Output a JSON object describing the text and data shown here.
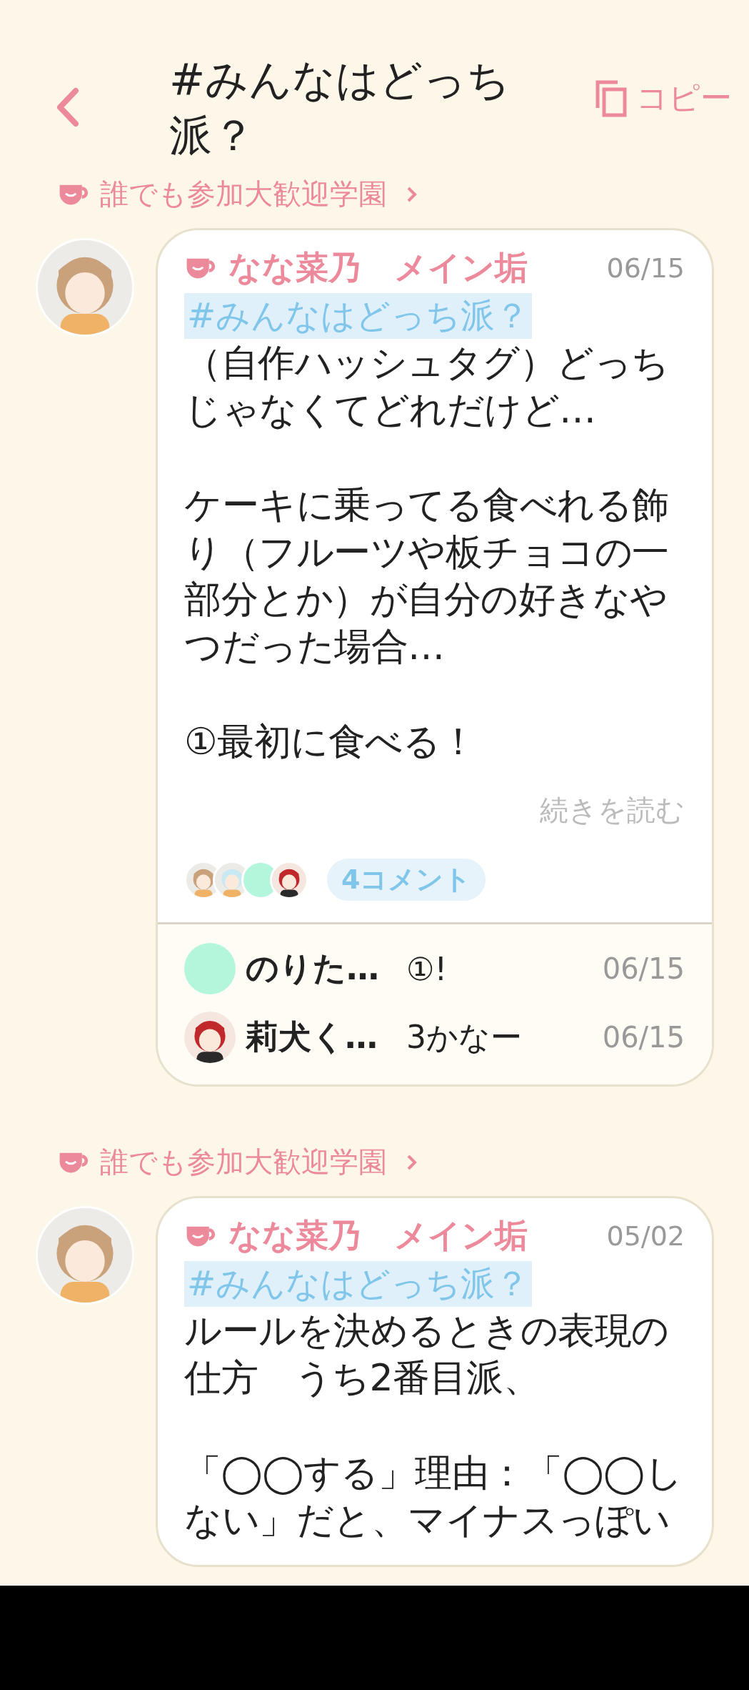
{
  "header": {
    "title": "#みんなはどっち派？",
    "copy_label": "コピー"
  },
  "posts": [
    {
      "community": "誰でも参加大歓迎学園",
      "author": "なな菜乃　メイン垢",
      "date": "06/15",
      "hashtag": "#みんなはどっち派？",
      "paragraphs": [
        "（自作ハッシュタグ）どっちじゃなくてどれだけど…",
        "ケーキに乗ってる食べれる飾り（フルーツや板チョコの一部分とか）が自分の好きなやつだった場合…",
        "①最初に食べる！"
      ],
      "read_more": "続きを読む",
      "commenters": [
        {
          "kind": "picture"
        },
        {
          "kind": "picture"
        },
        {
          "kind": "color",
          "color": "#b4f6dc"
        },
        {
          "kind": "picture"
        }
      ],
      "comment_count": "4コメント",
      "comments": [
        {
          "name": "のりた…",
          "text": "①!",
          "date": "06/15",
          "avatar": {
            "kind": "color",
            "color": "#b4f6dc"
          }
        },
        {
          "name": "莉犬く…",
          "text": "3かなー",
          "date": "06/15",
          "avatar": {
            "kind": "picture"
          }
        }
      ]
    },
    {
      "community": "誰でも参加大歓迎学園",
      "author": "なな菜乃　メイン垢",
      "date": "05/02",
      "hashtag": "#みんなはどっち派？",
      "paragraphs": [
        "ルールを決めるときの表現の仕方　うち2番目派、",
        "「◯◯する」理由：「◯◯しない」だと、マイナスっぽい"
      ]
    }
  ]
}
